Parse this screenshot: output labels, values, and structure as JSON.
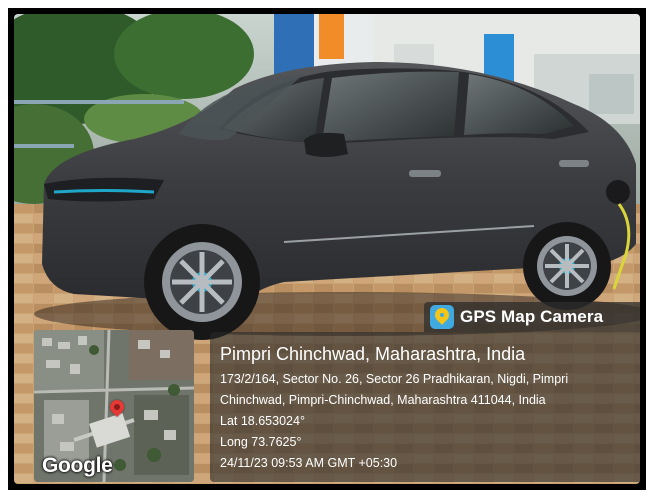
{
  "badge": {
    "title": "GPS Map Camera",
    "icon": "gps-map-camera-icon"
  },
  "location": {
    "title": "Pimpri Chinchwad, Maharashtra, India",
    "address_line1": "173/2/164, Sector No. 26, Sector 26 Pradhikaran, Nigdi, Pimpri",
    "address_line2": "Chinchwad, Pimpri-Chinchwad, Maharashtra 411044, India",
    "lat": "Lat 18.653024°",
    "long": "Long 73.7625°",
    "timestamp": "24/11/23 09:53 AM GMT +05:30"
  },
  "map": {
    "logo": "Google",
    "pin_color": "#e53935"
  },
  "colors": {
    "car_body": "#3a3a3c",
    "accent": "#1fa7c9",
    "badge_icon": "#3fa9e0"
  }
}
